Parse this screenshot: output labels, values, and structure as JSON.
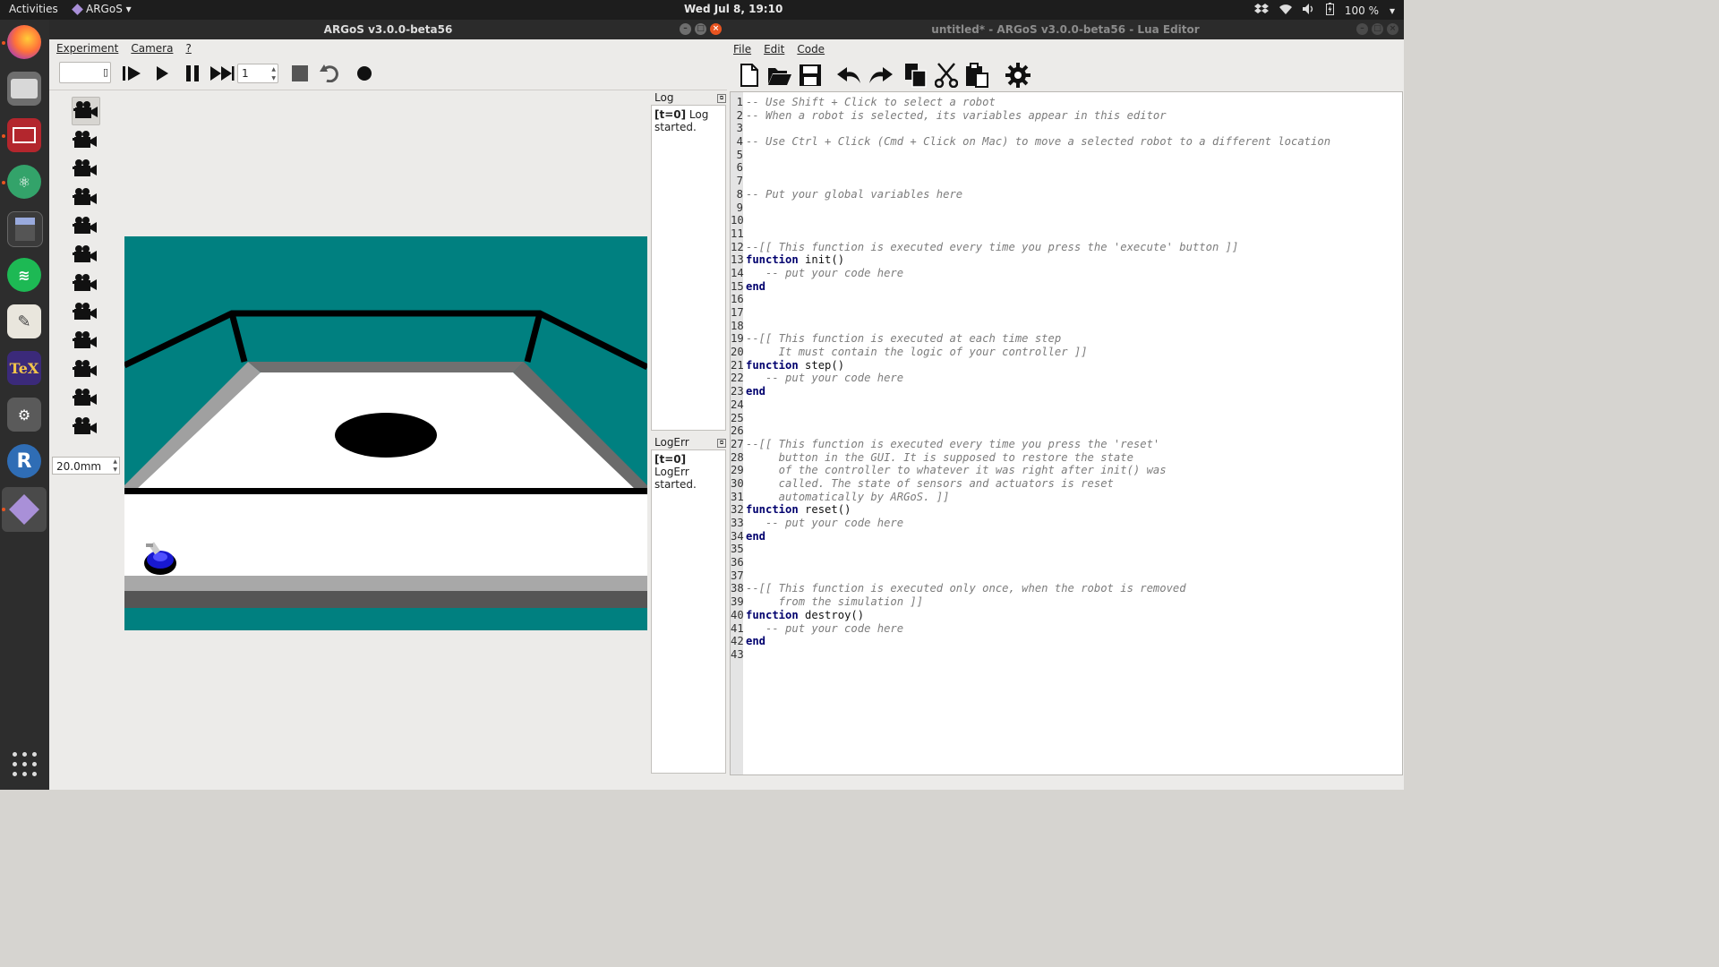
{
  "topbar": {
    "activities": "Activities",
    "app_name": "ARGoS",
    "clock": "Wed Jul  8, 19:10",
    "battery": "100 %"
  },
  "dock": {
    "apps": [
      "firefox-icon",
      "files-icon",
      "video-recorder-icon",
      "atom-icon",
      "calculator-icon",
      "spotify-icon",
      "text-editor-icon",
      "texmaker-icon",
      "system-settings-icon",
      "r-icon",
      "argos-icon"
    ]
  },
  "argos": {
    "title": "ARGoS v3.0.0-beta56",
    "menu": [
      "Experiment",
      "Camera",
      "?"
    ],
    "steps_value": "1",
    "zoom_value": "20.0mm",
    "log_title": "Log",
    "log_tag": "[t=0]",
    "log_text": " Log started.",
    "logerr_title": "LogErr",
    "logerr_tag": "[t=0]",
    "logerr_text": " LogErr started.",
    "camera_count": 12,
    "colors": {
      "teal": "#008080",
      "floor": "#ffffff",
      "wall": "#a9a9a9",
      "robot": "#1010c8"
    }
  },
  "lua": {
    "title": "untitled* - ARGoS v3.0.0-beta56 - Lua Editor",
    "menu": [
      "File",
      "Edit",
      "Code"
    ],
    "toolbar": [
      "new-file-icon",
      "open-folder-icon",
      "save-icon",
      "undo-icon",
      "redo-icon",
      "copy-icon",
      "cut-icon",
      "paste-icon",
      "settings-gear-icon"
    ],
    "lines": [
      {
        "n": "1",
        "t": "-- Use Shift + Click to select a robot",
        "k": "c"
      },
      {
        "n": "2",
        "t": "-- When a robot is selected, its variables appear in this editor",
        "k": "c"
      },
      {
        "n": "3",
        "t": "",
        "k": "p"
      },
      {
        "n": "4",
        "t": "-- Use Ctrl + Click (Cmd + Click on Mac) to move a selected robot to a different location",
        "k": "c"
      },
      {
        "n": "5",
        "t": "",
        "k": "p"
      },
      {
        "n": "6",
        "t": "",
        "k": "p"
      },
      {
        "n": "7",
        "t": "",
        "k": "p"
      },
      {
        "n": "8",
        "t": "-- Put your global variables here",
        "k": "c"
      },
      {
        "n": "9",
        "t": "",
        "k": "p"
      },
      {
        "n": "10",
        "t": "",
        "k": "p"
      },
      {
        "n": "11",
        "t": "",
        "k": "p"
      },
      {
        "n": "12",
        "t": "--[[ This function is executed every time you press the 'execute' button ]]",
        "k": "c"
      },
      {
        "n": "13",
        "t": "function init()",
        "k": "f"
      },
      {
        "n": "14",
        "t": "   -- put your code here",
        "k": "c"
      },
      {
        "n": "15",
        "t": "end",
        "k": "e"
      },
      {
        "n": "16",
        "t": "",
        "k": "p"
      },
      {
        "n": "17",
        "t": "",
        "k": "p"
      },
      {
        "n": "18",
        "t": "",
        "k": "p"
      },
      {
        "n": "19",
        "t": "--[[ This function is executed at each time step",
        "k": "c"
      },
      {
        "n": "20",
        "t": "     It must contain the logic of your controller ]]",
        "k": "c"
      },
      {
        "n": "21",
        "t": "function step()",
        "k": "f"
      },
      {
        "n": "22",
        "t": "   -- put your code here",
        "k": "c"
      },
      {
        "n": "23",
        "t": "end",
        "k": "e"
      },
      {
        "n": "24",
        "t": "",
        "k": "p"
      },
      {
        "n": "25",
        "t": "",
        "k": "p"
      },
      {
        "n": "26",
        "t": "",
        "k": "p"
      },
      {
        "n": "27",
        "t": "--[[ This function is executed every time you press the 'reset'",
        "k": "c"
      },
      {
        "n": "28",
        "t": "     button in the GUI. It is supposed to restore the state",
        "k": "c"
      },
      {
        "n": "29",
        "t": "     of the controller to whatever it was right after init() was",
        "k": "c"
      },
      {
        "n": "30",
        "t": "     called. The state of sensors and actuators is reset",
        "k": "c"
      },
      {
        "n": "31",
        "t": "     automatically by ARGoS. ]]",
        "k": "c"
      },
      {
        "n": "32",
        "t": "function reset()",
        "k": "f"
      },
      {
        "n": "33",
        "t": "   -- put your code here",
        "k": "c"
      },
      {
        "n": "34",
        "t": "end",
        "k": "e"
      },
      {
        "n": "35",
        "t": "",
        "k": "p"
      },
      {
        "n": "36",
        "t": "",
        "k": "p"
      },
      {
        "n": "37",
        "t": "",
        "k": "p"
      },
      {
        "n": "38",
        "t": "--[[ This function is executed only once, when the robot is removed",
        "k": "c"
      },
      {
        "n": "39",
        "t": "     from the simulation ]]",
        "k": "c"
      },
      {
        "n": "40",
        "t": "function destroy()",
        "k": "f"
      },
      {
        "n": "41",
        "t": "   -- put your code here",
        "k": "c"
      },
      {
        "n": "42",
        "t": "end",
        "k": "e"
      },
      {
        "n": "43",
        "t": "",
        "k": "cur"
      }
    ]
  }
}
